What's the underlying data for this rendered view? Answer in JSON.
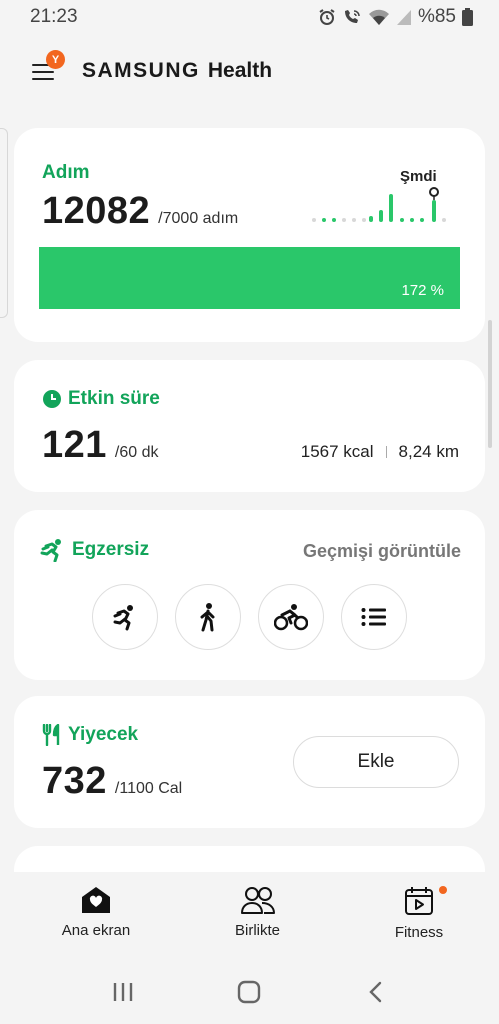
{
  "status_bar": {
    "time": "21:23",
    "battery": "%85",
    "icons": [
      "alarm-icon",
      "wifi-call-icon",
      "wifi-icon",
      "signal-icon",
      "battery-icon"
    ]
  },
  "app_bar": {
    "menu_badge": "Y",
    "brand_left": "SAMSUNG",
    "brand_right": "Health"
  },
  "steps": {
    "title": "Adım",
    "value": "12082",
    "goal": "/7000 adım",
    "now_label": "Şmdi",
    "progress_label": "172 %",
    "progress_percent": 172
  },
  "active_time": {
    "title": "Etkin süre",
    "value": "121",
    "goal": "/60 dk",
    "calories": "1567 kcal",
    "distance": "8,24 km"
  },
  "exercise": {
    "title": "Egzersiz",
    "history_link": "Geçmişi görüntüle",
    "buttons": [
      "running-icon",
      "walking-icon",
      "cycling-icon",
      "list-icon"
    ]
  },
  "food": {
    "title": "Yiyecek",
    "value": "732",
    "goal": "/1100 Cal",
    "add_label": "Ekle"
  },
  "bottom_nav": {
    "items": [
      {
        "label": "Ana ekran",
        "icon": "home-heart-icon"
      },
      {
        "label": "Birlikte",
        "icon": "people-icon"
      },
      {
        "label": "Fitness",
        "icon": "fitness-video-icon"
      }
    ]
  },
  "colors": {
    "accent_green": "#12a45a",
    "progress_green": "#2ac76a",
    "badge_orange": "#f2661f",
    "background": "#f4f4f4"
  }
}
